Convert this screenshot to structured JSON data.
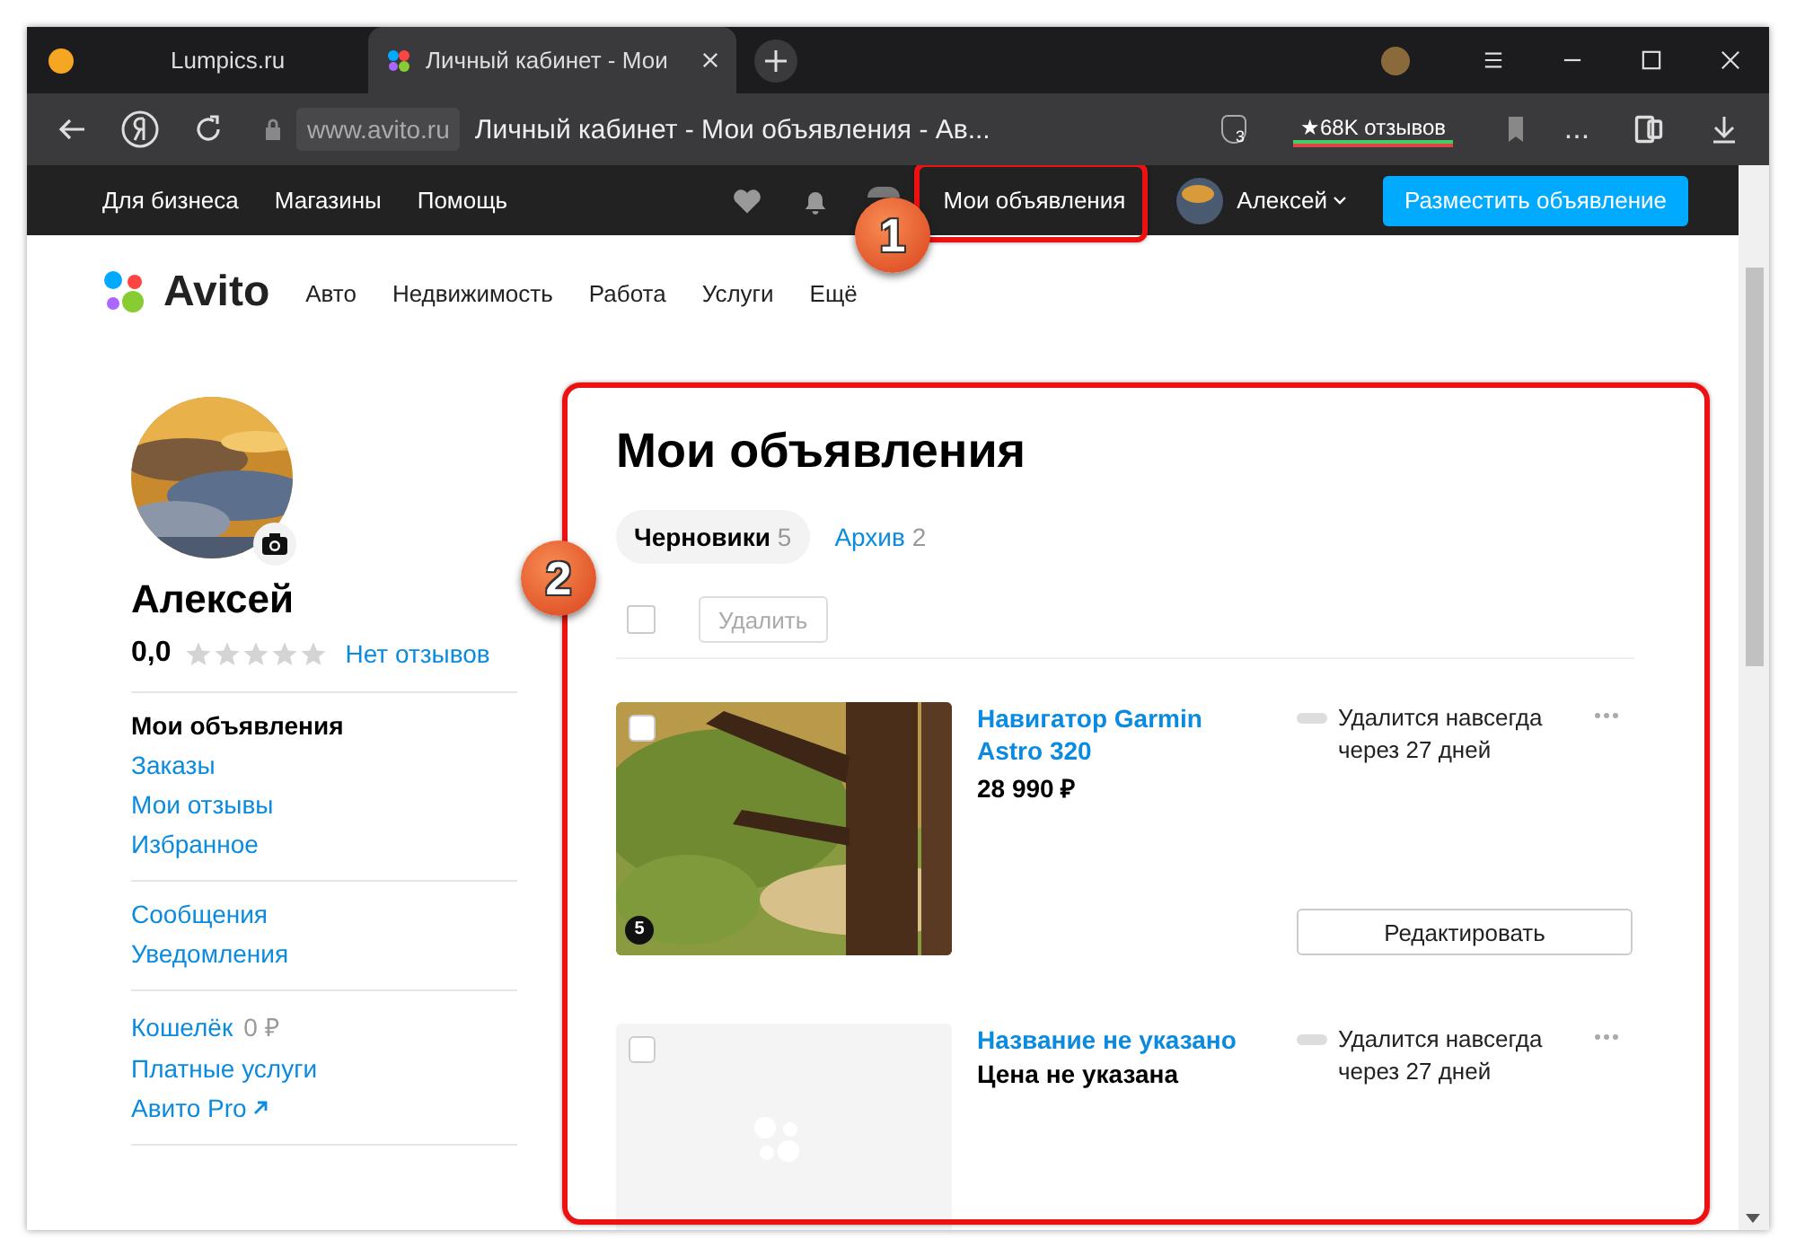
{
  "browser": {
    "tabs": [
      {
        "label": "Lumpics.ru",
        "selected": false
      },
      {
        "label": "Личный кабинет - Мои",
        "selected": true
      }
    ],
    "address": {
      "domain": "www.avito.ru",
      "title": "Личный кабинет - Мои объявления - Ав..."
    },
    "shield_count": "3",
    "reviews": "★68K отзывов",
    "more": "..."
  },
  "site_bar": {
    "links": [
      "Для бизнеса",
      "Магазины",
      "Помощь"
    ],
    "my_ads": "Мои объявления",
    "user": "Алексей",
    "post_button": "Разместить объявление"
  },
  "nav": {
    "logo": "Avito",
    "items": [
      "Авто",
      "Недвижимость",
      "Работа",
      "Услуги",
      "Ещё"
    ]
  },
  "profile": {
    "name": "Алексей",
    "rating": "0,0",
    "stars": 0,
    "reviews_link": "Нет отзывов",
    "menu": [
      [
        {
          "label": "Мои объявления",
          "selected": true
        },
        {
          "label": "Заказы",
          "selected": false
        },
        {
          "label": "Мои отзывы",
          "selected": false
        },
        {
          "label": "Избранное",
          "selected": false
        }
      ],
      [
        {
          "label": "Сообщения",
          "selected": false
        },
        {
          "label": "Уведомления",
          "selected": false
        }
      ],
      [
        {
          "label": "Кошелёк",
          "value": "0 ₽",
          "selected": false
        },
        {
          "label": "Платные услуги",
          "selected": false
        },
        {
          "label": "Авито Pro",
          "external": true,
          "selected": false
        }
      ]
    ]
  },
  "main": {
    "title": "Мои объявления",
    "tabs": [
      {
        "label": "Черновики",
        "count": "5",
        "selected": true
      },
      {
        "label": "Архив",
        "count": "2",
        "selected": false
      }
    ],
    "select_all": {
      "checked": false
    },
    "delete_button": {
      "label": "Удалить",
      "disabled": true
    },
    "listings": [
      {
        "kind": "picture",
        "photo_count": "5",
        "title": "Навигатор Garmin Astro 320",
        "price": "28 990 ₽",
        "note": "Удалится навсегда через 27 дней",
        "checked": false,
        "edit_button": "Редактировать"
      },
      {
        "kind": "placeholder",
        "title": "Название не указано",
        "price": "Цена не указана",
        "note": "Удалится навсегда через 27 дней",
        "checked": false
      }
    ]
  },
  "annotations": [
    "1",
    "2"
  ]
}
